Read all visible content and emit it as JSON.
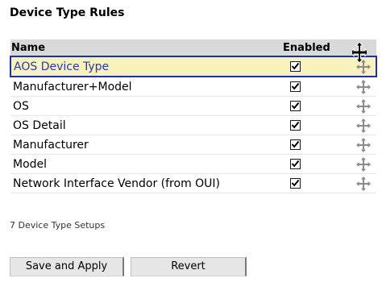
{
  "page": {
    "title": "Device Type Rules",
    "count_label": "7 Device Type Setups"
  },
  "table": {
    "headers": {
      "name": "Name",
      "enabled": "Enabled"
    },
    "rows": [
      {
        "name": "AOS Device Type",
        "enabled": true,
        "selected": true
      },
      {
        "name": "Manufacturer+Model",
        "enabled": true,
        "selected": false
      },
      {
        "name": "OS",
        "enabled": true,
        "selected": false
      },
      {
        "name": "OS Detail",
        "enabled": true,
        "selected": false
      },
      {
        "name": "Manufacturer",
        "enabled": true,
        "selected": false
      },
      {
        "name": "Model",
        "enabled": true,
        "selected": false
      },
      {
        "name": "Network Interface Vendor (from OUI)",
        "enabled": true,
        "selected": false
      }
    ]
  },
  "buttons": {
    "save_label": "Save and Apply",
    "revert_label": "Revert"
  },
  "colors": {
    "selection_border": "#1c2fb3",
    "selection_text": "#2638c4",
    "selection_bg": "#f7f3ba",
    "header_bg": "#d9d9d9"
  },
  "icons": {
    "move_row": "move-arrows-icon",
    "cursor": "move-cursor-icon"
  }
}
